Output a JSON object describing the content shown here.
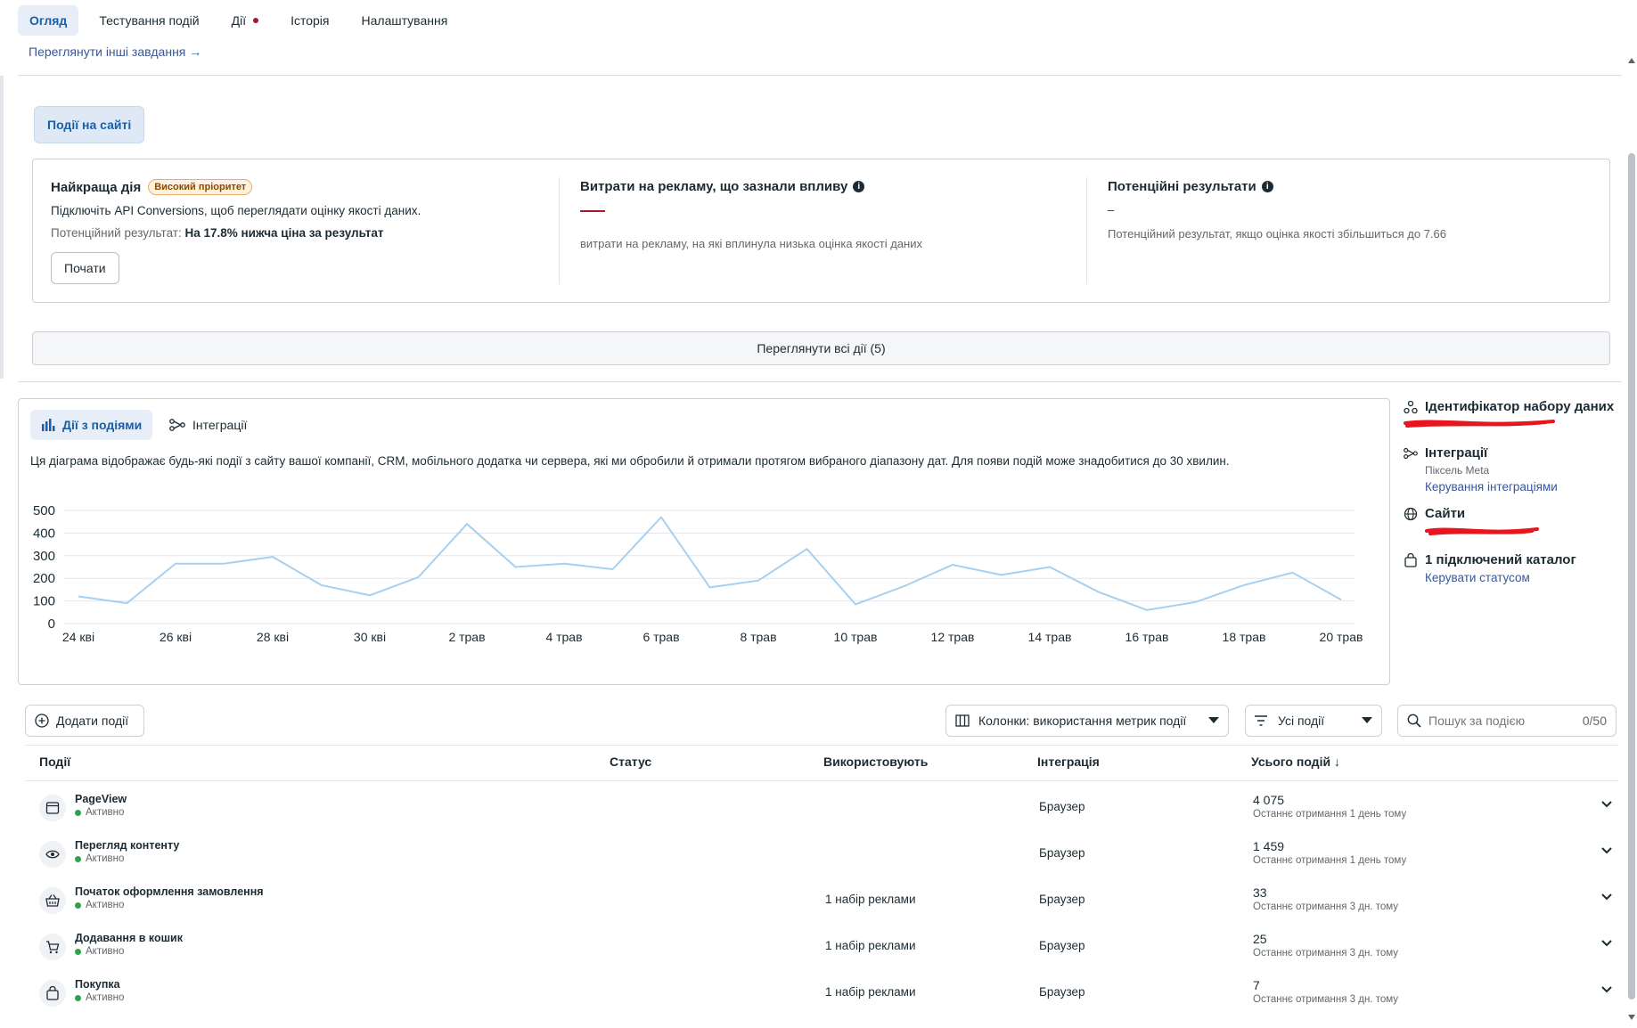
{
  "tabs": [
    {
      "label": "Огляд",
      "active": true
    },
    {
      "label": "Тестування подій",
      "active": false
    },
    {
      "label": "Дії",
      "active": false,
      "has_alert": true
    },
    {
      "label": "Історія",
      "active": false
    },
    {
      "label": "Налаштування",
      "active": false
    }
  ],
  "view_other_tasks": "Переглянути інші завдання →",
  "events_on_site_label": "Події на сайті",
  "best_action": {
    "title": "Найкраща дія",
    "badge": "Високий пріоритет",
    "description": "Підключіть API Conversions, щоб переглядати оцінку якості даних.",
    "potential_label": "Потенційний результат:",
    "potential_value": "На 17.8% нижча ціна за результат",
    "start_button": "Почати"
  },
  "ad_spend": {
    "title": "Витрати на рекламу, що зазнали впливу",
    "description": "витрати на рекламу, на які вплинула низька оцінка якості даних"
  },
  "potential_results": {
    "title": "Потенційні результати",
    "value": "–",
    "description": "Потенційний результат, якщо оцінка якості збільшиться до 7.66"
  },
  "view_all_actions": "Переглянути всі дії (5)",
  "chart_tabs": {
    "activity": "Дії з подіями",
    "integrations": "Інтеграції"
  },
  "chart_description": "Ця діаграма відображає будь-які події з сайту вашої компанії, CRM, мобільного додатка чи сервера, які ми обробили й отримали протягом вибраного діапазону дат. Для появи подій може знадобитися до 30 хвилин.",
  "chart_data": {
    "type": "line",
    "y_ticks": [
      "500",
      "400",
      "300",
      "200",
      "100",
      "0"
    ],
    "ylim": [
      0,
      500
    ],
    "x_tick_labels": [
      "24 кві",
      "26 кві",
      "28 кві",
      "30 кві",
      "2 трав",
      "4 трав",
      "6 трав",
      "8 трав",
      "10 трав",
      "12 трав",
      "14 трав",
      "16 трав",
      "18 трав",
      "20 трав"
    ],
    "x": [
      "24 кві",
      "25 кві",
      "26 кві",
      "27 кві",
      "28 кві",
      "29 кві",
      "30 кві",
      "1 трав",
      "2 трав",
      "3 трав",
      "4 трав",
      "5 трав",
      "6 трав",
      "7 трав",
      "8 трав",
      "9 трав",
      "10 трав",
      "11 трав",
      "12 трав",
      "13 трав",
      "14 трав",
      "15 трав",
      "16 трав",
      "17 трав",
      "18 трав",
      "19 трав",
      "20 трав"
    ],
    "series": [
      {
        "values": [
          120,
          90,
          265,
          265,
          295,
          170,
          125,
          205,
          440,
          250,
          265,
          240,
          470,
          160,
          190,
          330,
          85,
          165,
          260,
          215,
          250,
          140,
          60,
          95,
          170,
          225,
          105
        ]
      }
    ],
    "line_color": "#a8d0ee",
    "grid": true
  },
  "side_info": {
    "dataset_id_title": "Ідентифікатор набору даних",
    "integrations_title": "Інтеграції",
    "integrations_sub": "Піксель Meta",
    "integrations_link": "Керування інтеграціями",
    "sites_title": "Сайти",
    "catalog_title": "1 підключений каталог",
    "catalog_link": "Керувати статусом",
    "redaction_color": "#e8141e"
  },
  "toolbar": {
    "add_events": "Додати події",
    "columns": "Колонки: використання метрик події",
    "filter": "Усі події",
    "search_placeholder": "Пошук за подією",
    "search_count": "0/50"
  },
  "table": {
    "headers": {
      "events": "Події",
      "status": "Статус",
      "used_by": "Використовують",
      "integration": "Інтеграція",
      "total": "Усього подій ↓"
    },
    "rows": [
      {
        "icon": "browser-window-icon",
        "name": "PageView",
        "status": "Активно",
        "used_by": "",
        "integration": "Браузер",
        "total": "4 075",
        "last": "Останнє отримання 1 день тому"
      },
      {
        "icon": "eye-icon",
        "name": "Перегляд контенту",
        "status": "Активно",
        "used_by": "",
        "integration": "Браузер",
        "total": "1 459",
        "last": "Останнє отримання 1 день тому"
      },
      {
        "icon": "basket-icon",
        "name": "Початок оформлення замовлення",
        "status": "Активно",
        "used_by": "1 набір реклами",
        "integration": "Браузер",
        "total": "33",
        "last": "Останнє отримання 3 дн. тому"
      },
      {
        "icon": "cart-icon",
        "name": "Додавання в кошик",
        "status": "Активно",
        "used_by": "1 набір реклами",
        "integration": "Браузер",
        "total": "25",
        "last": "Останнє отримання 3 дн. тому"
      },
      {
        "icon": "shopping-bag-icon",
        "name": "Покупка",
        "status": "Активно",
        "used_by": "1 набір реклами",
        "integration": "Браузер",
        "total": "7",
        "last": "Останнє отримання 3 дн. тому"
      }
    ]
  }
}
